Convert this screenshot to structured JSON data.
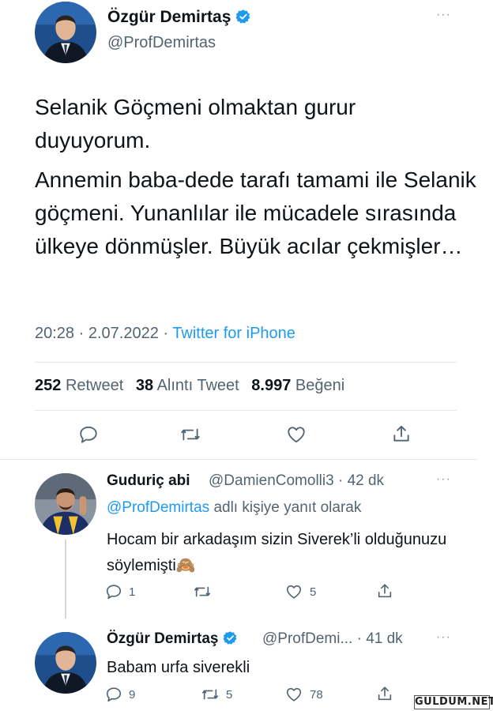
{
  "main_tweet": {
    "name": "Özgür Demirtaş",
    "handle": "@ProfDemirtas",
    "paragraph_1": "Selanik Göçmeni olmaktan gurur duyuyorum.",
    "paragraph_2": "Annemin baba-dede tarafı tamami ile Selanik göçmeni. Yunanlılar ile mücadele sırasında ülkeye dönmüşler. Büyük acılar çekmişler…",
    "time": "20:28",
    "date": "2.07.2022",
    "source": "Twitter for iPhone",
    "retweets": "252",
    "retweets_label": "Retweet",
    "quotes": "38",
    "quotes_label": "Alıntı Tweet",
    "likes": "8.997",
    "likes_label": "Beğeni",
    "separator": "·"
  },
  "reply_1": {
    "name": "Guduriç abi",
    "handle": "@DamienComolli3",
    "time": "42 dk",
    "reply_to_handle": "@ProfDemirtas",
    "reply_to_suffix": "adlı kişiye yanıt olarak",
    "text": "Hocam bir arkadaşım sizin Siverek’li olduğunuzu söylemişti🙈",
    "reply_count": "1",
    "retweet_count": "",
    "like_count": "5"
  },
  "reply_2": {
    "name": "Özgür Demirtaş",
    "handle": "@ProfDemi...",
    "time": "41 dk",
    "text": "Babam urfa siverekli",
    "reply_count": "9",
    "retweet_count": "5",
    "like_count": "78"
  },
  "menu_dots": "···",
  "watermark": "GULDUM.NET",
  "colors": {
    "accent": "#1d9bf0",
    "text": "#0f1419",
    "muted": "#536471",
    "divider": "#e3e8ec"
  },
  "icons": [
    "verified-badge-icon",
    "more-icon",
    "reply-icon",
    "retweet-icon",
    "like-icon",
    "share-icon"
  ]
}
